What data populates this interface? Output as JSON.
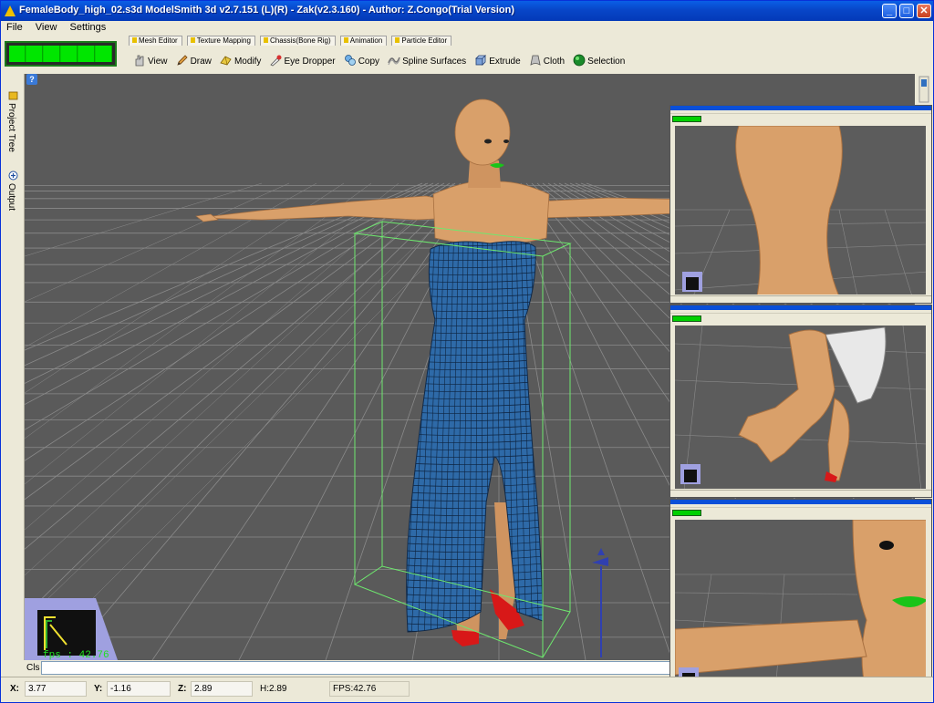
{
  "window": {
    "title": "FemaleBody_high_02.s3d ModelSmith 3d v2.7.151 (L)(R) - Zak(v2.3.160) - Author: Z.Congo(Trial Version)",
    "minimize_label": "_",
    "maximize_label": "□",
    "close_label": "✕"
  },
  "menu": [
    "File",
    "View",
    "Settings"
  ],
  "tabs": [
    "Mesh Editor",
    "Texture Mapping",
    "Chassis(Bone Rig)",
    "Animation",
    "Particle Editor"
  ],
  "toolbar": [
    {
      "label": "View",
      "icon": "hand-icon"
    },
    {
      "label": "Draw",
      "icon": "pencil-icon"
    },
    {
      "label": "Modify",
      "icon": "modify-icon"
    },
    {
      "label": "Eye Dropper",
      "icon": "eye-dropper-icon"
    },
    {
      "label": "Copy",
      "icon": "copy-icon"
    },
    {
      "label": "Spline Surfaces",
      "icon": "spline-icon"
    },
    {
      "label": "Extrude",
      "icon": "extrude-icon"
    },
    {
      "label": "Cloth",
      "icon": "cloth-icon"
    },
    {
      "label": "Selection",
      "icon": "selection-icon"
    }
  ],
  "left_dock": {
    "project_tree": "Project Tree",
    "output": "Output"
  },
  "viewport": {
    "help": "?",
    "fps_overlay": "fps : 42.76",
    "gizmo_x": "x",
    "gizmo_y": "y"
  },
  "console": {
    "cls_label": "Cls",
    "value": ""
  },
  "status": {
    "x_label": "X:",
    "x_value": "3.77",
    "y_label": "Y:",
    "y_value": "-1.16",
    "z_label": "Z:",
    "z_value": "2.89",
    "h_value": "H:2.89",
    "fps_label": "FPS:",
    "fps_value": "42.76"
  },
  "colors": {
    "dress": "#2e6aa8",
    "skin": "#d9a06a",
    "lips": "#19c419",
    "shoes": "#d81818",
    "viewport": "#5a5a5a",
    "grid": "#8a8a8a",
    "bbox": "#6ee86e"
  }
}
